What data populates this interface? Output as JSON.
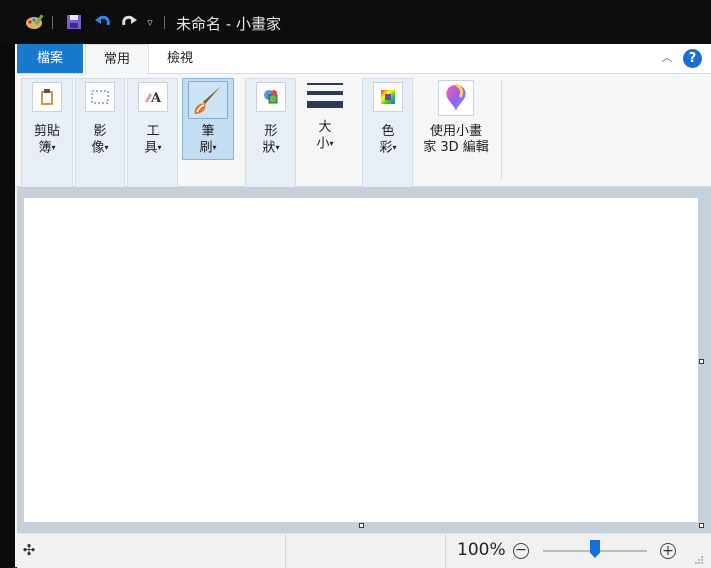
{
  "window": {
    "title": "未命名 - 小畫家"
  },
  "tabs": [
    {
      "label": "檔案"
    },
    {
      "label": "常用"
    },
    {
      "label": "檢視"
    }
  ],
  "ribbon": {
    "clipboard": {
      "label_1": "剪貼",
      "label_2": "簿"
    },
    "image": {
      "label_1": "影",
      "label_2": "像"
    },
    "tools": {
      "label_1": "工",
      "label_2": "具"
    },
    "brushes": {
      "label_1": "筆",
      "label_2": "刷"
    },
    "shapes": {
      "label_1": "形",
      "label_2": "狀"
    },
    "size": {
      "label_1": "大",
      "label_2": "小"
    },
    "colors": {
      "label_1": "色",
      "label_2": "彩"
    },
    "paint3d": {
      "label_1": "使用小畫",
      "label_2": "家 3D 編輯"
    },
    "dropdown_arrow": "▾"
  },
  "statusbar": {
    "zoom_level": "100%",
    "zoom_out_symbol": "−",
    "zoom_in_symbol": "+",
    "zoom_slider_value": 0.5
  },
  "icons": {
    "app": "paint-palette-icon",
    "save": "save-icon",
    "undo": "undo-icon",
    "redo": "redo-icon",
    "customize": "customize-quick-access-icon",
    "help": "help-icon",
    "collapse": "chevron-up-icon",
    "move": "move-cursor-icon"
  },
  "colors": {
    "file_tab": "#1979ca",
    "title_bar": "#0d0d0d",
    "workspace": "#c6d0dd",
    "accent": "#1470d6"
  }
}
